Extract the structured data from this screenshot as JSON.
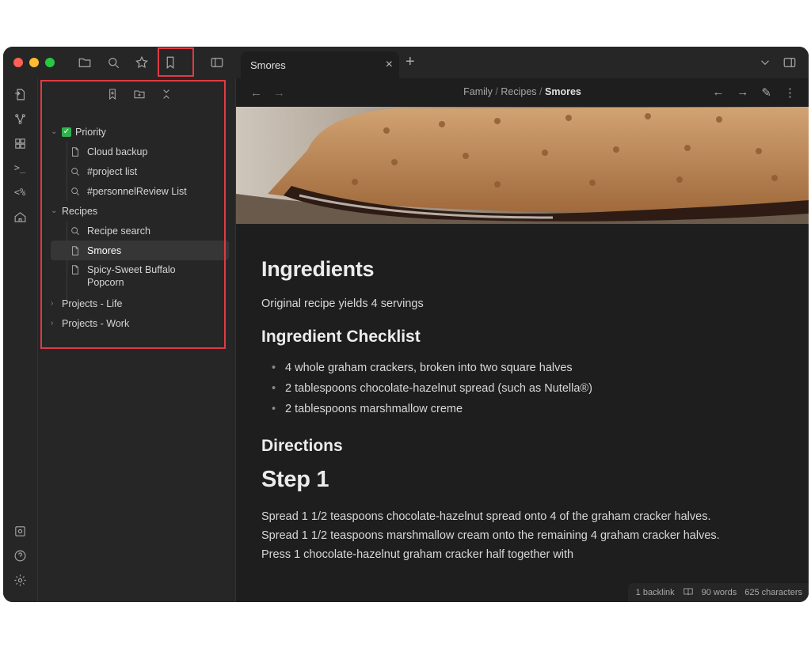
{
  "tab": {
    "title": "Smores",
    "close": "×",
    "new": "+"
  },
  "breadcrumb": {
    "parts": [
      "Family",
      "Recipes",
      "Smores"
    ],
    "separator": "/"
  },
  "bookmarks": {
    "groups": [
      {
        "label": "Priority",
        "checked": true,
        "items": [
          {
            "type": "file",
            "label": "Cloud backup"
          },
          {
            "type": "search",
            "label": "#project list"
          },
          {
            "type": "search",
            "label": "#personnelReview List"
          }
        ]
      },
      {
        "label": "Recipes",
        "items": [
          {
            "type": "search",
            "label": "Recipe search"
          },
          {
            "type": "file",
            "label": "Smores",
            "selected": true
          },
          {
            "type": "file",
            "label": "Spicy-Sweet Buffalo Popcorn"
          }
        ]
      },
      {
        "label": "Projects - Life",
        "collapsed": true
      },
      {
        "label": "Projects - Work",
        "collapsed": true
      }
    ]
  },
  "note": {
    "h_ingredients": "Ingredients",
    "yield": "Original recipe yields 4 servings",
    "h_checklist": "Ingredient Checklist",
    "checklist": [
      "4 whole graham crackers, broken into two square halves",
      "2 tablespoons chocolate-hazelnut spread (such as Nutella®)",
      "2 tablespoons marshmallow creme"
    ],
    "h_directions": "Directions",
    "h_step1": "Step 1",
    "step1": [
      "Spread 1 1/2 teaspoons chocolate-hazelnut spread onto 4 of the graham cracker halves.",
      "Spread 1 1/2 teaspoons marshmallow cream onto the remaining 4 graham cracker halves.",
      "Press 1 chocolate-hazelnut graham cracker half together with"
    ]
  },
  "status": {
    "backlinks": "1 backlink",
    "words": "90 words",
    "characters": "625 characters"
  },
  "ribbon": {
    "terminal": ">_",
    "percent": "<%"
  },
  "colors": {
    "highlight": "#e03a45",
    "accent_check": "#2fb14c"
  }
}
